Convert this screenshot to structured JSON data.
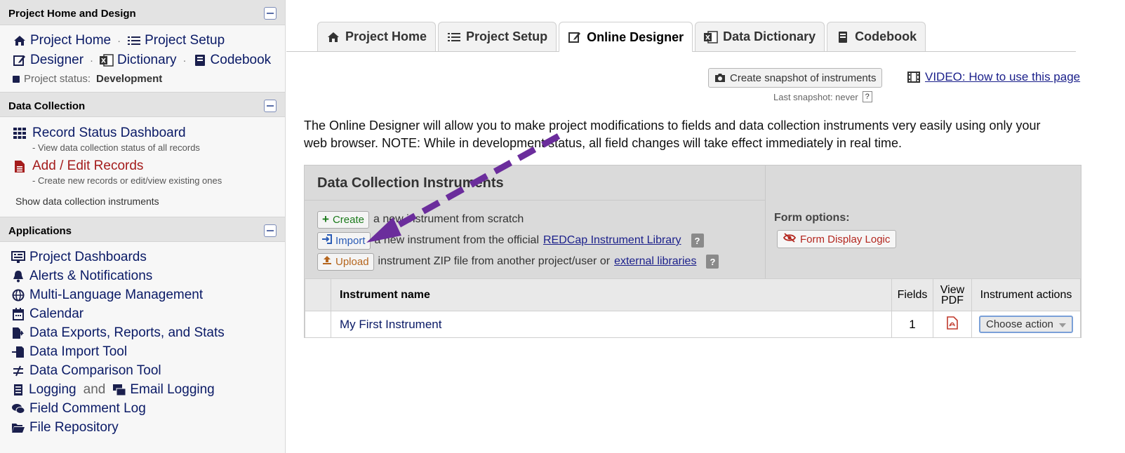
{
  "sidebar": {
    "project_section": {
      "title": "Project Home and Design",
      "links": {
        "project_home": "Project Home",
        "project_setup": "Project Setup",
        "designer": "Designer",
        "dictionary": "Dictionary",
        "codebook": "Codebook"
      },
      "status_label": "Project status:",
      "status_value": "Development"
    },
    "data_collection": {
      "title": "Data Collection",
      "record_status": "Record Status Dashboard",
      "record_status_sub": "- View data collection status of all records",
      "add_edit": "Add / Edit Records",
      "add_edit_sub": "- Create new records or edit/view existing ones",
      "show_instruments": "Show data collection instruments"
    },
    "applications": {
      "title": "Applications",
      "items": [
        "Project Dashboards",
        "Alerts & Notifications",
        "Multi-Language Management",
        "Calendar",
        "Data Exports, Reports, and Stats",
        "Data Import Tool",
        "Data Comparison Tool",
        "Logging",
        "Field Comment Log",
        "File Repository"
      ],
      "and_text": "and",
      "email_logging": "Email Logging"
    }
  },
  "tabs": [
    {
      "label": "Project Home",
      "icon": "home-icon"
    },
    {
      "label": "Project Setup",
      "icon": "tasks-icon"
    },
    {
      "label": "Online Designer",
      "icon": "edit-icon"
    },
    {
      "label": "Data Dictionary",
      "icon": "excel-icon"
    },
    {
      "label": "Codebook",
      "icon": "book-icon"
    }
  ],
  "snapshot": {
    "button_label": "Create snapshot of instruments",
    "last_snapshot": "Last snapshot: never",
    "help": "?"
  },
  "video_link": "VIDEO: How to use this page",
  "intro_text": "The Online Designer will allow you to make project modifications to fields and data collection instruments very easily using only your web browser. NOTE: While in development status, all field changes will take effect immediately in real time.",
  "instruments_panel": {
    "title": "Data Collection Instruments",
    "create_btn": "Create",
    "create_text": "a new instrument from scratch",
    "import_btn": "Import",
    "import_text": "a new instrument from the official",
    "import_link": "REDCap Instrument Library",
    "upload_btn": "Upload",
    "upload_text": "instrument ZIP file from another project/user or",
    "upload_link": "external libraries",
    "help": "?",
    "form_options_label": "Form options:",
    "form_display_logic": "Form Display Logic"
  },
  "table": {
    "headers": {
      "name": "Instrument name",
      "fields": "Fields",
      "view_pdf_1": "View",
      "view_pdf_2": "PDF",
      "actions": "Instrument actions"
    },
    "rows": [
      {
        "name": "My First Instrument",
        "fields": "1",
        "action": "Choose action"
      }
    ]
  },
  "colors": {
    "accent_arrow": "#6b2d9c",
    "link": "#0a1a66",
    "red_link": "#a41c1c"
  }
}
